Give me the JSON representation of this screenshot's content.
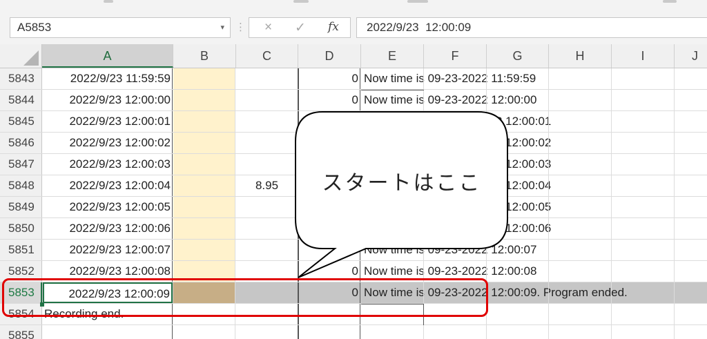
{
  "formula_bar": {
    "name_box": "A5853",
    "cancel_icon": "×",
    "enter_icon": "✓",
    "fx_label": "fx",
    "formula_value": "2022/9/23  12:00:09"
  },
  "columns": [
    "A",
    "B",
    "C",
    "D",
    "E",
    "F",
    "G",
    "H",
    "I",
    "J"
  ],
  "rows": [
    {
      "num": "5843",
      "a": "2022/9/23 11:59:59",
      "c": "",
      "d": "0",
      "e": "Now time is 09-23-2022 11:59:59"
    },
    {
      "num": "5844",
      "a": "2022/9/23 12:00:00",
      "c": "",
      "d": "0",
      "e": "Now time is 09-23-2022 12:00:00"
    },
    {
      "num": "5845",
      "a": "2022/9/23 12:00:01",
      "c": "",
      "d": "",
      "e": "2 12:00:01"
    },
    {
      "num": "5846",
      "a": "2022/9/23 12:00:02",
      "c": "",
      "d": "",
      "e": "2 12:00:02"
    },
    {
      "num": "5847",
      "a": "2022/9/23 12:00:03",
      "c": "",
      "d": "",
      "e": "2 12:00:03"
    },
    {
      "num": "5848",
      "a": "2022/9/23 12:00:04",
      "c": "8.95",
      "d": "",
      "e": "2 12:00:04"
    },
    {
      "num": "5849",
      "a": "2022/9/23 12:00:05",
      "c": "",
      "d": "",
      "e": "2 12:00:05"
    },
    {
      "num": "5850",
      "a": "2022/9/23 12:00:06",
      "c": "",
      "d": "",
      "e": "2 12:00:06"
    },
    {
      "num": "5851",
      "a": "2022/9/23 12:00:07",
      "c": "",
      "d": "",
      "e": "Now time is 09-23-2022 12:00:07"
    },
    {
      "num": "5852",
      "a": "2022/9/23 12:00:08",
      "c": "",
      "d": "0",
      "e": "Now time is 09-23-2022 12:00:08"
    },
    {
      "num": "5853",
      "a": "2022/9/23 12:00:09",
      "c": "",
      "d": "0",
      "e": "Now time is 09-23-2022 12:00:09. Program ended."
    },
    {
      "num": "5854",
      "a": "Recording end.",
      "c": "",
      "d": "",
      "e": ""
    },
    {
      "num": "5855",
      "a": "",
      "c": "",
      "d": "",
      "e": ""
    }
  ],
  "callout": {
    "text": "スタートはここ"
  },
  "colors": {
    "highlight": "#e00000",
    "selection": "#217346",
    "column_b_fill": "#fff2cc"
  }
}
